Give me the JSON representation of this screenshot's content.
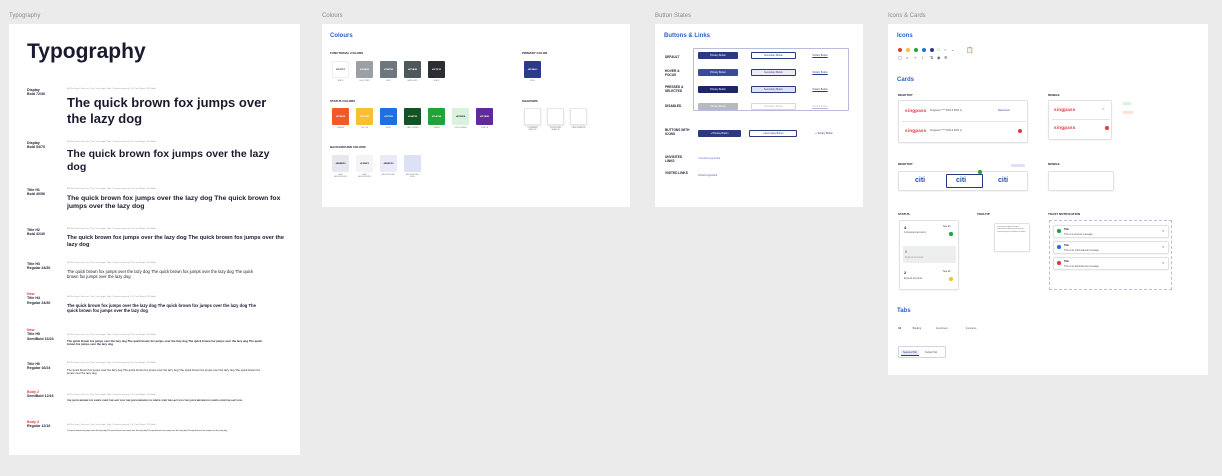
{
  "frames": {
    "typography": "Typography",
    "colours": "Colours",
    "button_states": "Button States",
    "icons_cards": "Icons & Cards"
  },
  "typography": {
    "title": "Typography",
    "meta": "Brill Pro Sans  |  Font size: 72px  |  Line height: 90px  |  Character spacing: 1%  |  Font Weight: 700 (Bold)",
    "rows": [
      {
        "tag1": "Display",
        "tag2": "Bold 72/36",
        "new": "",
        "sample": "The quick brown fox jumps over the lazy dog"
      },
      {
        "tag1": "Display",
        "tag2": "Bold 54/70",
        "new": "",
        "sample": "The quick brown fox jumps over the lazy dog"
      },
      {
        "tag1": "Title H1",
        "tag2": "Bold 40/56",
        "new": "",
        "sample": "The quick brown fox jumps over the lazy dog The quick brown fox jumps over the lazy dog"
      },
      {
        "tag1": "Title H2",
        "tag2": "Bold 32/40",
        "new": "",
        "sample": "The quick brown fox jumps over the lazy dog The quick brown fox jumps over the lazy dog"
      },
      {
        "tag1": "Title H3",
        "tag2": "Regular 24/30",
        "new": "",
        "sample": "The quick brown fox jumps over the lazy dog The quick brown fox jumps over the lazy dog The quick brown fox jumps over the lazy dog"
      },
      {
        "tag1": "Title H4",
        "tag2": "Regular 24/30",
        "new": "New",
        "sample": "The quick brown fox jumps over the lazy dog The quick brown fox jumps over the lazy dog The quick brown fox jumps over the lazy dog"
      },
      {
        "tag1": "Title H5",
        "tag2": "SemiBold 16/24",
        "new": "New",
        "sample": "The quick brown fox jumps over the lazy dog The quick brown fox jumps over the lazy dog The quick brown fox jumps over the lazy dog The quick brown fox jumps over the lazy dog"
      },
      {
        "tag1": "Title H6",
        "tag2": "Regular 16/24",
        "new": "",
        "sample": "The quick brown fox jumps over the lazy dog The quick brown fox jumps over the lazy dog The quick brown fox jumps over the lazy dog The quick brown fox jumps over the lazy dog"
      },
      {
        "tag1": "Body 2",
        "tag2": "SemiBold 12/16",
        "new": "",
        "sample": "THE QUICK BROWN FOX JUMPS OVER THE LAZY DOG THE QUICK BROWN FOX JUMPS OVER THE LAZY DOG THE QUICK BROWN FOX JUMPS OVER THE LAZY DOG"
      },
      {
        "tag1": "Body 3",
        "tag2": "Regular 12/16",
        "new": "",
        "sample": "The quick brown fox jumps over the lazy dog The quick brown fox jumps over the lazy dog The quick brown fox jumps over the lazy dog The quick brown fox jumps over the lazy dog"
      }
    ]
  },
  "colours": {
    "title": "Colours",
    "functional_label": "FUNCTIONAL COLORS",
    "functional": [
      {
        "hex": "#FFFFFF",
        "name": "WHITE",
        "color": "#ffffff",
        "text": "#333333"
      },
      {
        "hex": "#959BA3",
        "name": "LIGHT GREY",
        "color": "#9aa0a6",
        "text": "#ffffff"
      },
      {
        "hex": "#7B8F89",
        "name": "GREY",
        "color": "#6e767d",
        "text": "#ffffff"
      },
      {
        "hex": "#475A5B",
        "name": "DARK GREY",
        "color": "#4c585c",
        "text": "#ffffff"
      },
      {
        "hex": "#2C2F33",
        "name": "BLACK",
        "color": "#2b2f33",
        "text": "#ffffff"
      }
    ],
    "primary_label": "PRIMARY COLOR",
    "primary": {
      "hex": "#2D3A8C",
      "name": "BLUE",
      "color": "#2d3a8c"
    },
    "status_label": "STATUS COLORS",
    "status": [
      {
        "hex": "#F05A28",
        "name": "ORANGE",
        "color": "#ef5a28"
      },
      {
        "hex": "#F9C22E",
        "name": "YELLOW",
        "color": "#f7c032"
      },
      {
        "hex": "#1971E2",
        "name": "BLUE",
        "color": "#1f6fe0"
      },
      {
        "hex": "#144C2E",
        "name": "DARK GREEN",
        "color": "#155226"
      },
      {
        "hex": "#21A33A",
        "name": "GREEN",
        "color": "#22a33a"
      },
      {
        "hex": "#E5F6E8",
        "name": "LIGHT GREEN",
        "color": "#d9f2dd"
      },
      {
        "hex": "#5F2B9E",
        "name": "PURPLE",
        "color": "#61299b"
      }
    ],
    "shadows_label": "SHADOWS",
    "shadows": [
      "CONTAINER SHADOW",
      "DROPDOWN SHADOW",
      "CARD SHADOW"
    ],
    "background_label": "BACKGROUND COLORS",
    "background": [
      {
        "hex": "#EBEBF0",
        "name": "DEEP BACKGROUND",
        "color": "#e6e7ef"
      },
      {
        "hex": "#F4F4F5",
        "name": "LIGHT BACKGROUND",
        "color": "#f4f4f6"
      },
      {
        "hex": "#EBEDF9",
        "name": "BACKGROUND",
        "color": "#e9ebf8"
      },
      {
        "hex": "",
        "name": "BACKGROUND BLUE",
        "color": "#dde1f6"
      }
    ]
  },
  "buttons": {
    "title": "Buttons & Links",
    "states": [
      "DEFAULT",
      "HOVER & FOCUS",
      "PRESSED & SELECTED",
      "DISABLED"
    ],
    "primary": "Primary Button",
    "secondary": "Secondary Button",
    "tertiary": "Tertiary Button",
    "icons_label": "BUTTONS WITH ICONS",
    "unvisited_label": "UNVISITED LINKS",
    "unvisited_link": "Unvisited Hyperlink",
    "visited_label": "VISITED LINKS",
    "visited_link": "Visited Hyperlink"
  },
  "icons_cards": {
    "icons_title": "Icons",
    "cards_title": "Cards",
    "desktop": "DESKTOP",
    "mobile": "MOBILE",
    "airline_name": "singpass",
    "card_row1": "Singpass (**** 5003 & 6061 1)",
    "card_row1_action": "Disconnect",
    "card_row2": "Singpass (**** 5003 & 6061 1)",
    "citi_name": "citi",
    "status_label": "STATUS",
    "tooltip_label": "TOOLTIP",
    "toast_label": "TOAST NOTIFICATION",
    "status_items": [
      {
        "count": "4",
        "text": "Connected accounts",
        "link": "See all"
      },
      {
        "count": "0",
        "text": "Expired accounts",
        "link": ""
      },
      {
        "count": "2",
        "text": "Expired accounts",
        "link": "See all"
      }
    ],
    "tooltip_text": "Lorem ipsum dolor sit amet consectetur adipiscing elit sed do eiusmod tempor incididunt ut labore",
    "toasts": [
      {
        "title": "Title",
        "msg": "This is a success message.",
        "color": "#22a33a"
      },
      {
        "title": "Title",
        "msg": "This is an informational message.",
        "color": "#1f6fe0"
      },
      {
        "title": "Title",
        "msg": "This is an alert/warning message.",
        "color": "#e4393b"
      }
    ],
    "tabs_title": "Tabs",
    "tabs": [
      "All",
      "Banking",
      "Investment",
      "Insurance"
    ],
    "tabs2": [
      "Selected Tab",
      "Default Tab"
    ]
  }
}
